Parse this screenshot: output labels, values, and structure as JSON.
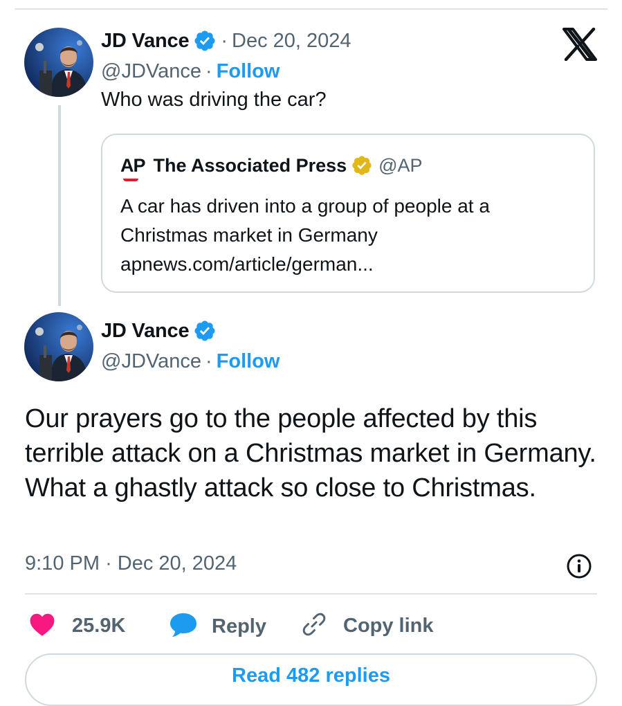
{
  "brand": {
    "logo_icon": "x-logo-icon"
  },
  "reply_to": {
    "author_name": "JD Vance",
    "handle": "@JDVance",
    "separator": "·",
    "date": "Dec 20, 2024",
    "follow_label": "Follow",
    "text": "Who was driving the car?",
    "quoted": {
      "logo_text": "AP",
      "author_name": "The Associated Press",
      "handle": "@AP",
      "lines": [
        "A car has driven into a group of people at a",
        "Christmas market in Germany",
        "apnews.com/article/german..."
      ]
    }
  },
  "main_tweet": {
    "author_name": "JD Vance",
    "handle": "@JDVance",
    "separator": "·",
    "follow_label": "Follow",
    "text": "Our prayers go to the people affected by this terrible attack on a Christmas market in Germany. What a ghastly attack so close to Christmas.",
    "time": "9:10 PM",
    "date": "Dec 20, 2024"
  },
  "actions": {
    "likes": "25.9K",
    "reply_label": "Reply",
    "copy_link_label": "Copy link"
  },
  "read_replies_label": "Read 482 replies",
  "colors": {
    "accent": "#1d9bf0",
    "like": "#f91880",
    "verified_blue": "#1d9bf0",
    "verified_gold": "#e2b719",
    "ap_red": "#e21b2d"
  }
}
